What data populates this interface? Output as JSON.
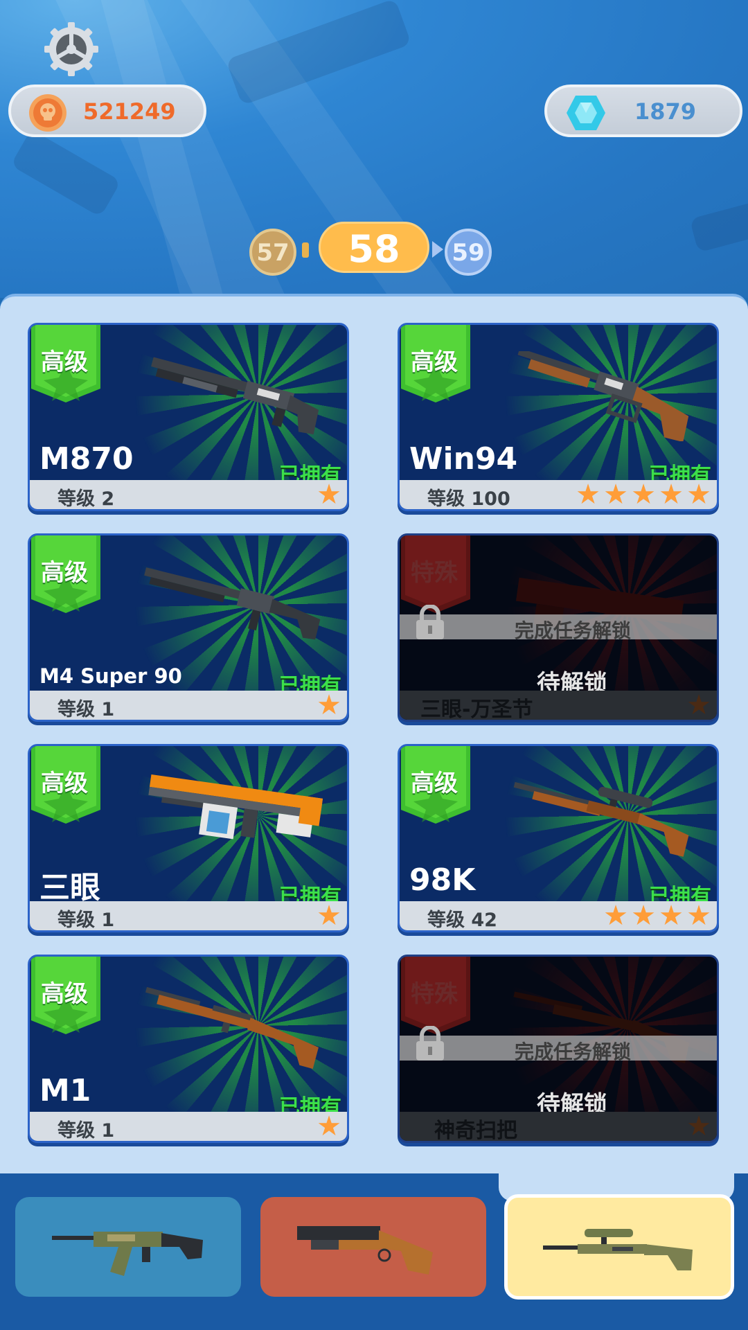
{
  "header": {
    "coins": "521249",
    "gems": "1879",
    "level_prev": "57",
    "level_current": "58",
    "level_next": "59"
  },
  "cards": [
    {
      "tier": "高级",
      "name": "M870",
      "status": "已拥有",
      "level": "等级 2",
      "stars": 1,
      "locked": false
    },
    {
      "tier": "高级",
      "name": "Win94",
      "status": "已拥有",
      "level": "等级 100",
      "stars": 5,
      "locked": false
    },
    {
      "tier": "高级",
      "name": "M4 Super 90",
      "status": "已拥有",
      "level": "等级 1",
      "stars": 1,
      "locked": false
    },
    {
      "tier": "特殊",
      "name": "三眼-万圣节",
      "unlock_hint": "完成任务解锁",
      "pending": "待解锁",
      "stars": 1,
      "locked": true
    },
    {
      "tier": "高级",
      "name": "三眼",
      "status": "已拥有",
      "level": "等级 1",
      "stars": 1,
      "locked": false
    },
    {
      "tier": "高级",
      "name": "98K",
      "status": "已拥有",
      "level": "等级 42",
      "stars": 4,
      "locked": false
    },
    {
      "tier": "高级",
      "name": "M1",
      "status": "已拥有",
      "level": "等级 1",
      "stars": 1,
      "locked": false
    },
    {
      "tier": "特殊",
      "name": "神奇扫把",
      "unlock_hint": "完成任务解锁",
      "pending": "待解锁",
      "stars": 1,
      "locked": true
    }
  ],
  "tabs": [
    {
      "icon": "assault-rifle-icon",
      "color": "#3a8dbd"
    },
    {
      "icon": "shotgun-icon",
      "color": "#c55e48"
    },
    {
      "icon": "sniper-rifle-icon",
      "color": "#ffeaa0",
      "selected": true
    }
  ],
  "colors": {
    "owned_green": "#3ce04a",
    "star_orange": "#ff9d38",
    "coin_orange": "#ef6a2a",
    "gem_blue": "#4a8fcf"
  }
}
